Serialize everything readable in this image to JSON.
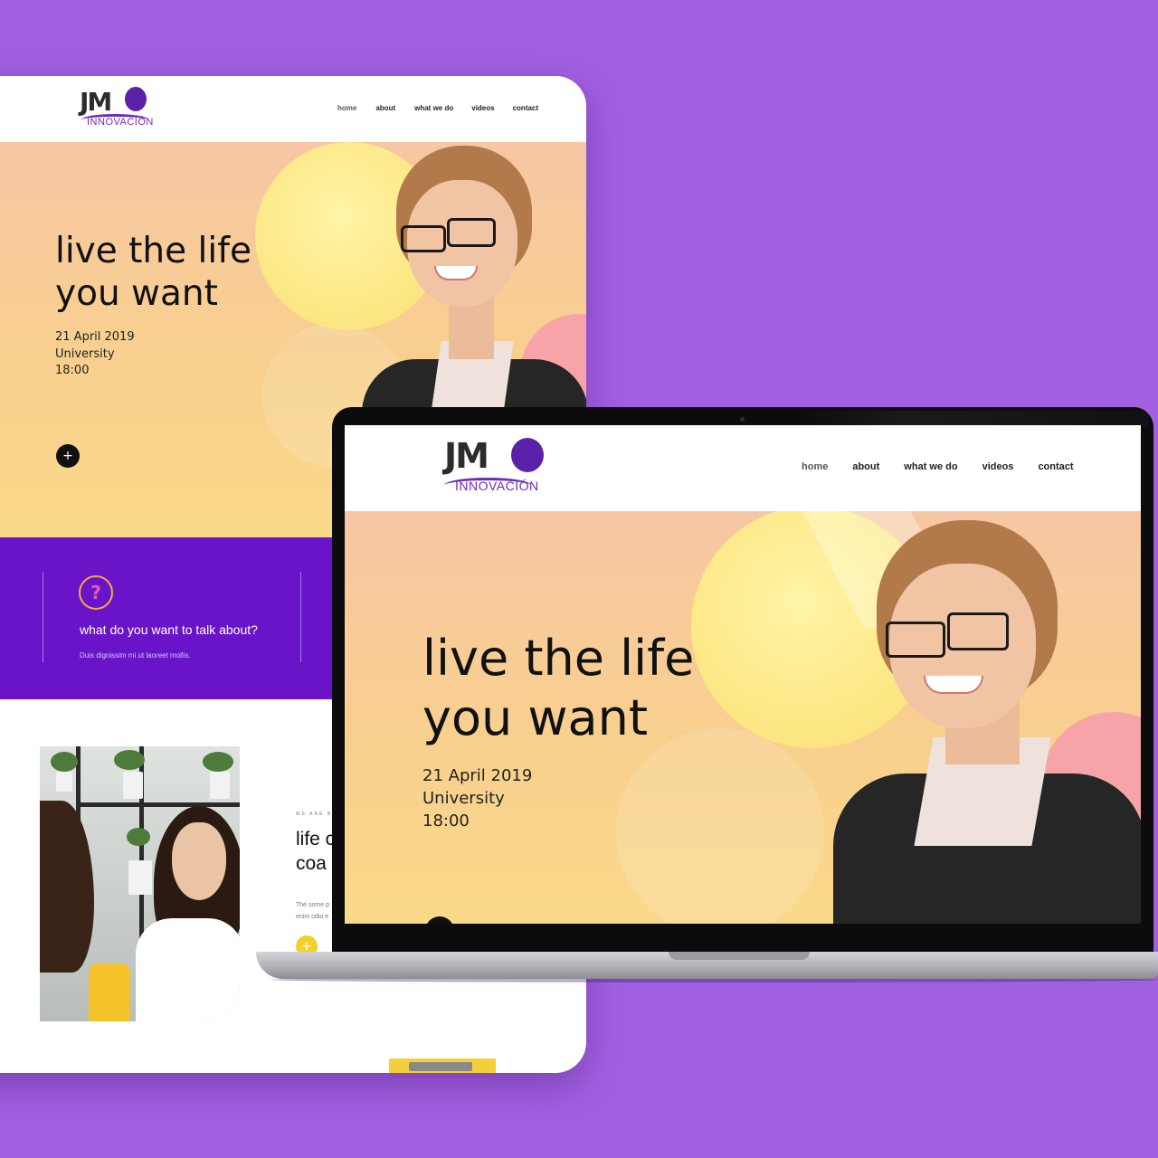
{
  "colors": {
    "background": "#a160e0",
    "brand_purple": "#6a14c9",
    "accent_yellow": "#f2d12a",
    "accent_pink": "#f7a4a8"
  },
  "brand": {
    "mark": "JM",
    "name": "INNOVACIÓN"
  },
  "nav": [
    "home",
    "about",
    "what we do",
    "videos",
    "contact"
  ],
  "hero": {
    "headline_line1": "live the life",
    "headline_line2": "you want",
    "date": "21 April 2019",
    "location": "University",
    "time": "18:00",
    "cta_icon": "plus-icon"
  },
  "feature": {
    "icon": "question-bubble-icon",
    "title": "what do you want to talk about?",
    "text": "Duis dignissim mi ut laoreet mollis."
  },
  "about": {
    "eyebrow": "WE ARE B",
    "title_line1": "life c",
    "title_line2": "coa",
    "text_line1": "The some p",
    "text_line2": "enim odio e",
    "button_icon": "plus-icon"
  }
}
